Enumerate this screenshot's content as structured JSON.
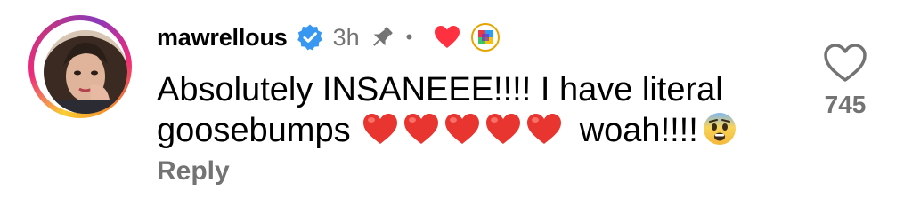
{
  "comment": {
    "username": "mawrellous",
    "verified": true,
    "timestamp": "3h",
    "pinned": true,
    "liked_by_creator": true,
    "text_before": "Absolutely INSANEEE!!!! I have literal goosebumps",
    "heart_emoji_count": 5,
    "text_after": "woah!!!!",
    "trailing_emoji": "fearful-face-emoji",
    "reply_label": "Reply",
    "like_count": "745"
  },
  "icons": {
    "verified": "verified-badge-icon",
    "pin": "pin-icon",
    "creator_heart": "heart-filled-icon",
    "like": "heart-outline-icon"
  },
  "colors": {
    "verified_blue": "#3897f0",
    "heart_red": "#ff3040",
    "muted_text": "#737373",
    "ring_start": "#f9ce34",
    "ring_mid": "#ee2a7b",
    "ring_end": "#8a3ab9"
  }
}
